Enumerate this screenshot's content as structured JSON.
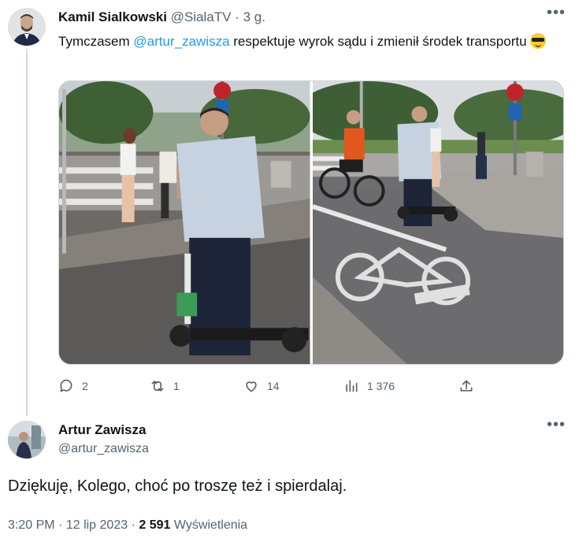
{
  "tweet": {
    "author_name": "Kamil Sialkowski",
    "author_handle": "@SialaTV",
    "separator": "·",
    "time": "3 g.",
    "more": "•••",
    "text_before": "Tymczasem ",
    "mention": "@artur_zawisza",
    "text_after": " respektuje wyrok sądu i zmienił środek transportu",
    "emoji_icon": "sunglasses-face-emoji",
    "media": {
      "photos": [
        {
          "name": "photo-man-on-scooter-crosswalk"
        },
        {
          "name": "photo-man-on-scooter-bike-lane"
        }
      ]
    },
    "actions": {
      "reply_count": "2",
      "retweet_count": "1",
      "like_count": "14",
      "views_count": "1 376"
    }
  },
  "reply": {
    "author_name": "Artur Zawisza",
    "author_handle": "@artur_zawisza",
    "more": "•••",
    "text": "Dziękuję, Kolego, choć po troszę też i spierdalaj.",
    "time": "3:20 PM",
    "separator": "·",
    "date": "12 lip 2023",
    "views_count": "2 591",
    "views_label": "Wyświetlenia"
  },
  "colors": {
    "text_primary": "#0f1419",
    "text_secondary": "#536471",
    "link": "#1d9bf0",
    "thread_line": "#cfd9de"
  }
}
